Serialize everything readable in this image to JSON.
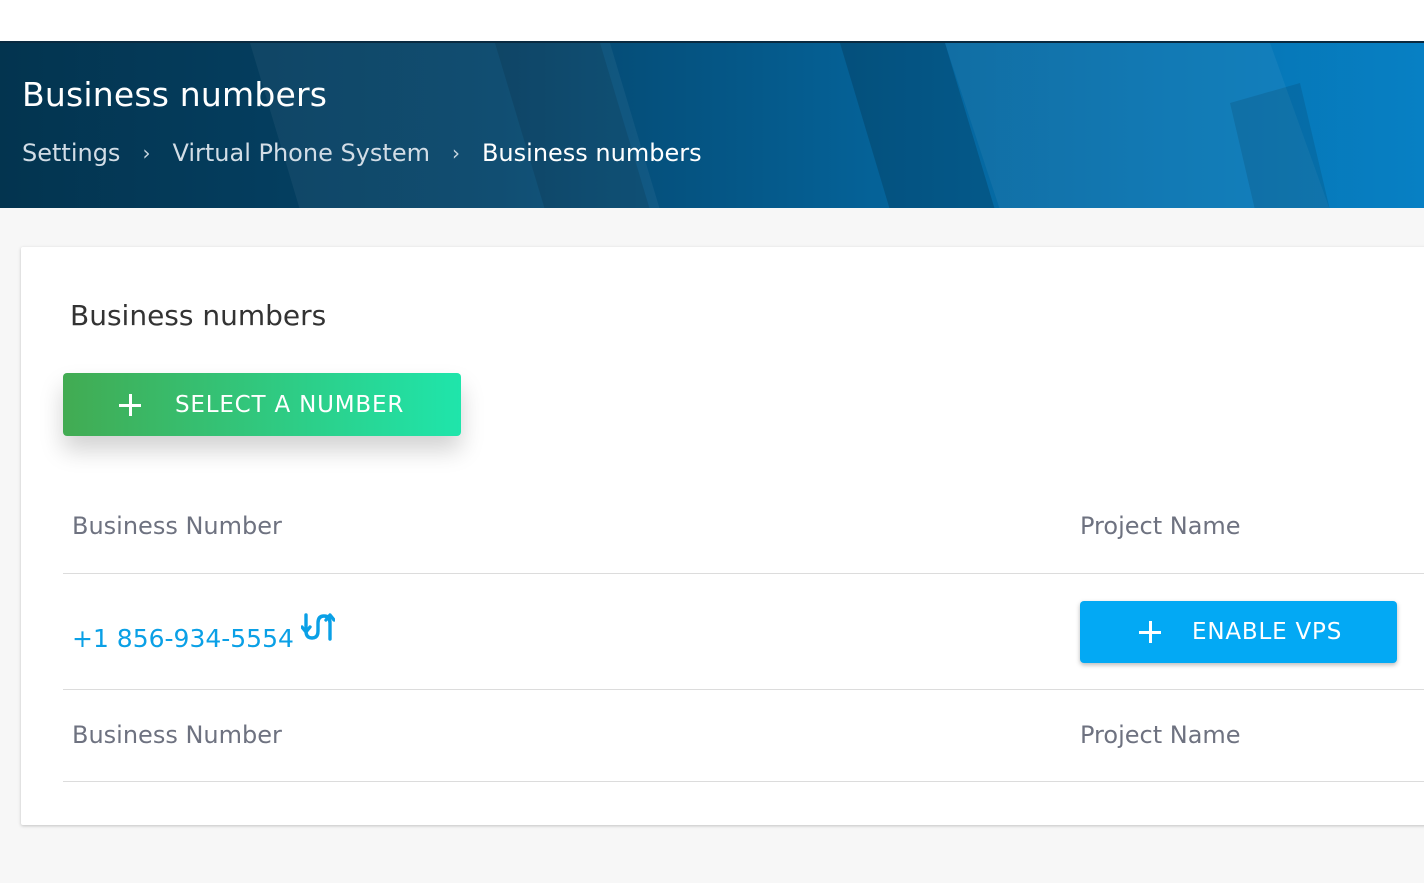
{
  "header": {
    "title": "Business numbers",
    "breadcrumb": [
      {
        "label": "Settings"
      },
      {
        "label": "Virtual Phone System"
      },
      {
        "label": "Business numbers"
      }
    ],
    "separator": "›"
  },
  "card": {
    "title": "Business numbers",
    "select_button_label": "SELECT A NUMBER"
  },
  "table": {
    "columns": [
      "Business Number",
      "Project Name"
    ],
    "rows": [
      {
        "number": "+1 856-934-5554",
        "icon": "transfer-arrows-icon",
        "action_label": "ENABLE VPS"
      }
    ],
    "footer_columns": [
      "Business Number",
      "Project Name"
    ]
  },
  "colors": {
    "banner_dark": "#03344f",
    "banner_light": "#0780c4",
    "select_button_start": "#42ab52",
    "select_button_end": "#1fe5ab",
    "link": "#0aa0e6",
    "vps_button": "#03a9f4"
  }
}
